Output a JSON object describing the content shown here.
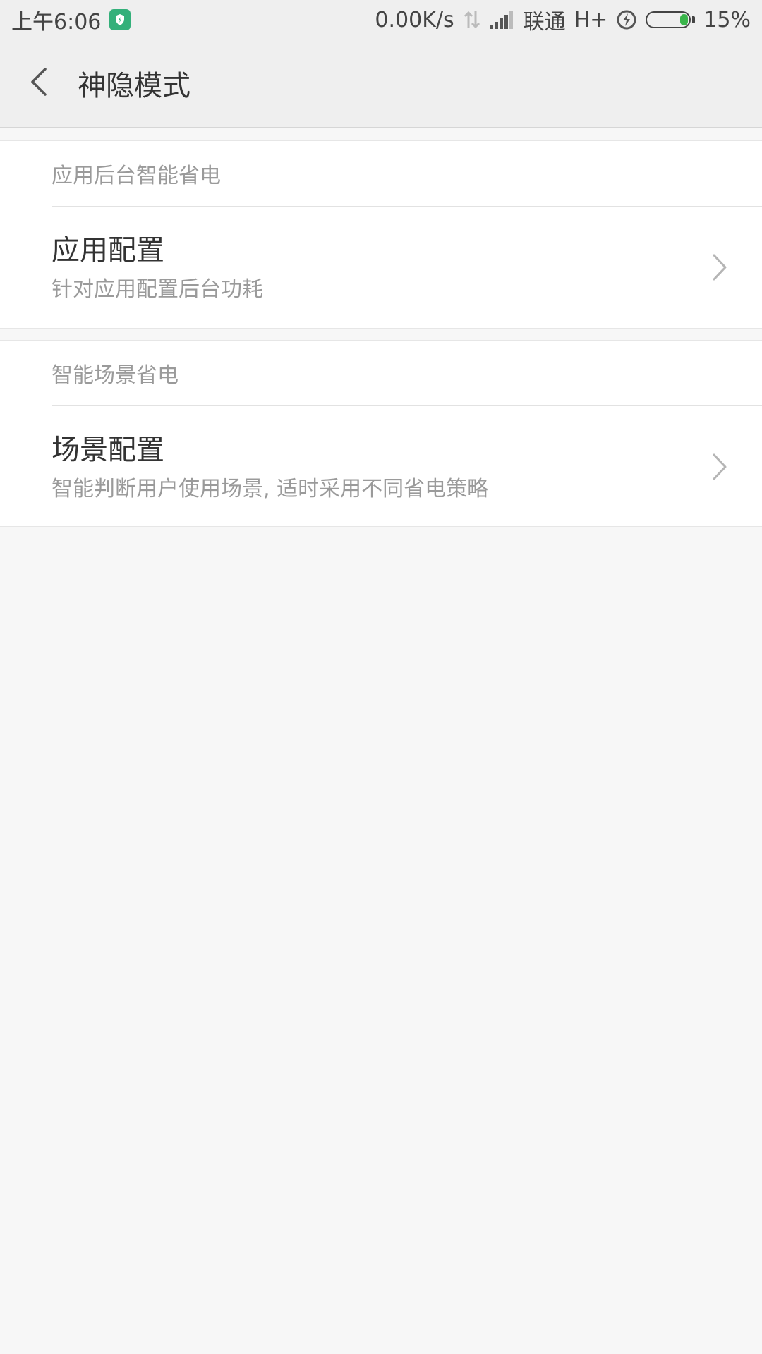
{
  "status_bar": {
    "time": "上午6:06",
    "network_speed": "0.00K/s",
    "carrier": "联通",
    "network_type": "H+",
    "battery_percent": "15%",
    "battery_level": 0.15,
    "icons": [
      "shield-icon",
      "data-arrows-icon",
      "signal-icon",
      "charging-icon",
      "battery-icon"
    ],
    "colors": {
      "shield": "#33b07a",
      "battery_fill": "#39b54a"
    }
  },
  "header": {
    "title": "神隐模式",
    "back_icon": "chevron-left-icon"
  },
  "sections": [
    {
      "header": "应用后台智能省电",
      "items": [
        {
          "title": "应用配置",
          "subtitle": "针对应用配置后台功耗",
          "icon": "chevron-right-icon"
        }
      ]
    },
    {
      "header": "智能场景省电",
      "items": [
        {
          "title": "场景配置",
          "subtitle": "智能判断用户使用场景, 适时采用不同省电策略",
          "icon": "chevron-right-icon"
        }
      ]
    }
  ]
}
